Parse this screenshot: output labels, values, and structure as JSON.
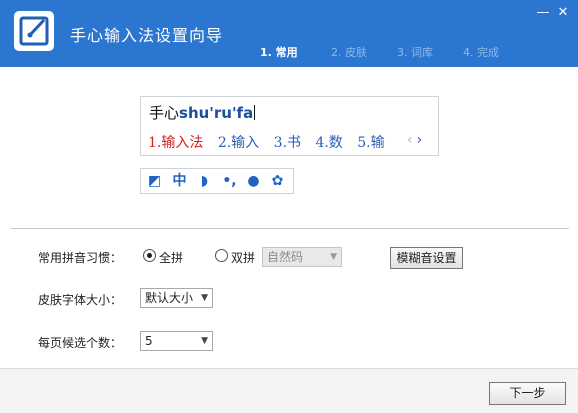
{
  "window": {
    "title": "手心输入法设置向导",
    "min_glyph": "—",
    "close_glyph": "✕"
  },
  "steps": [
    {
      "label": "1. 常用",
      "active": true
    },
    {
      "label": "2. 皮肤",
      "active": false
    },
    {
      "label": "3. 词库",
      "active": false
    },
    {
      "label": "4. 完成",
      "active": false
    }
  ],
  "preview": {
    "prefix": "手心",
    "pinyin": "shu'ru'fa",
    "candidates": [
      {
        "text": "1.输入法",
        "selected": true
      },
      {
        "text": "2.输入",
        "selected": false
      },
      {
        "text": "3.书",
        "selected": false
      },
      {
        "text": "4.数",
        "selected": false
      },
      {
        "text": "5.输",
        "selected": false
      }
    ],
    "prev_glyph": "‹",
    "next_glyph": "›"
  },
  "statusbar": {
    "icons": [
      {
        "name": "brand-icon",
        "glyph": "◩"
      },
      {
        "name": "chinese-mode-icon",
        "glyph": "中"
      },
      {
        "name": "halfwidth-moon-icon",
        "glyph": "◗"
      },
      {
        "name": "punctuation-icon",
        "glyph": "•,"
      },
      {
        "name": "user-icon",
        "glyph": "●"
      },
      {
        "name": "settings-gear-icon",
        "glyph": "✿"
      }
    ]
  },
  "settings": {
    "pinyin_habit": {
      "label": "常用拼音习惯：",
      "options": [
        {
          "label": "全拼",
          "checked": true
        },
        {
          "label": "双拼",
          "checked": false
        }
      ],
      "scheme_value": "自然码",
      "fuzzy_button": "模糊音设置"
    },
    "skin_font_size": {
      "label": "皮肤字体大小：",
      "value": "默认大小"
    },
    "candidates_per_page": {
      "label": "每页候选个数：",
      "value": "5"
    }
  },
  "footer": {
    "next_button": "下一步"
  },
  "colors": {
    "titlebar": "#2a76d0",
    "selected_candidate": "#d62020",
    "candidate": "#2b5fb4"
  }
}
